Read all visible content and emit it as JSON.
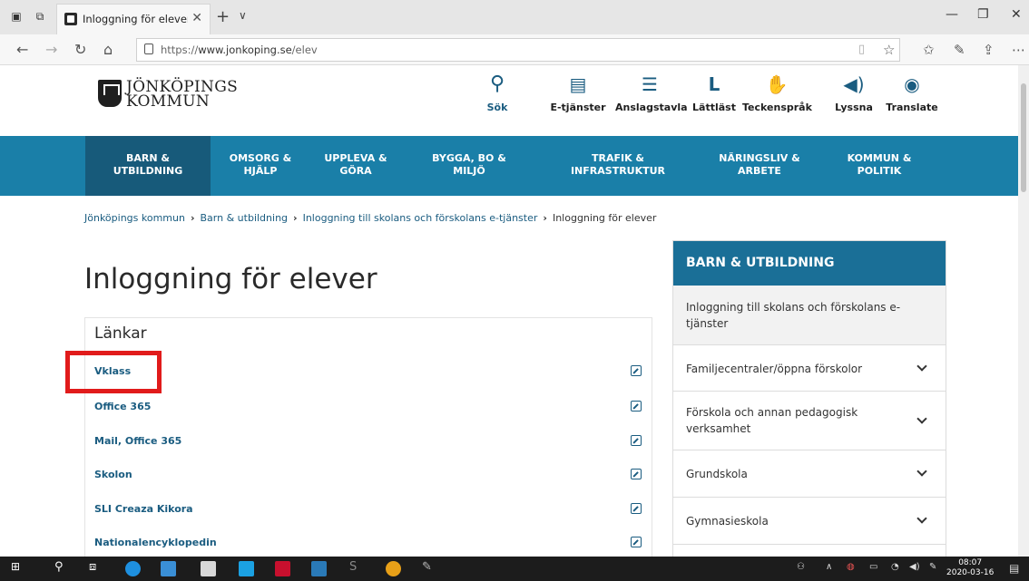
{
  "browser": {
    "tab_title": "Inloggning för elever - J",
    "url_proto": "https://",
    "url_host": "www.jonkoping.se",
    "url_path": "/elev"
  },
  "site": {
    "logo_line1": "JÖNKÖPINGS",
    "logo_line2": "KOMMUN",
    "header_links": [
      {
        "label": "Sök",
        "icon": "search-icon"
      },
      {
        "label": "E-tjänster",
        "icon": "e-services-icon"
      },
      {
        "label": "Anslagstavla",
        "icon": "notice-board-icon"
      },
      {
        "label": "Lättläst",
        "icon": "easy-read-icon"
      },
      {
        "label": "Teckenspråk",
        "icon": "sign-language-icon"
      },
      {
        "label": "Lyssna",
        "icon": "speaker-icon"
      },
      {
        "label": "Translate",
        "icon": "translate-icon"
      }
    ],
    "main_nav": [
      {
        "line1": "BARN &",
        "line2": "UTBILDNING"
      },
      {
        "line1": "OMSORG &",
        "line2": "HJÄLP"
      },
      {
        "line1": "UPPLEVA &",
        "line2": "GÖRA"
      },
      {
        "line1": "BYGGA, BO &",
        "line2": "MILJÖ"
      },
      {
        "line1": "TRAFIK &",
        "line2": "INFRASTRUKTUR"
      },
      {
        "line1": "NÄRINGSLIV &",
        "line2": "ARBETE"
      },
      {
        "line1": "KOMMUN &",
        "line2": "POLITIK"
      }
    ],
    "breadcrumb": [
      "Jönköpings kommun",
      "Barn & utbildning",
      "Inloggning till skolans och förskolans e-tjänster",
      "Inloggning för elever"
    ]
  },
  "page": {
    "title": "Inloggning för elever",
    "links_heading": "Länkar",
    "links": [
      "Vklass",
      "Office 365",
      "Mail, Office 365",
      "Skolon",
      "SLI Creaza Kikora",
      "Nationalencyklopedin"
    ]
  },
  "sidebar": {
    "header": "BARN & UTBILDNING",
    "current": "Inloggning till skolans och förskolans e-tjänster",
    "items": [
      "Familjecentraler/öppna förskolor",
      "Förskola och annan pedagogisk verksamhet",
      "Grundskola",
      "Gymnasieskola"
    ]
  },
  "taskbar": {
    "time": "08:07",
    "date": "2020-03-16"
  },
  "colors": {
    "nav_blue": "#1a7fa8",
    "nav_active": "#175a7a",
    "link_blue": "#1a5c80",
    "highlight_red": "#e11b1b"
  }
}
